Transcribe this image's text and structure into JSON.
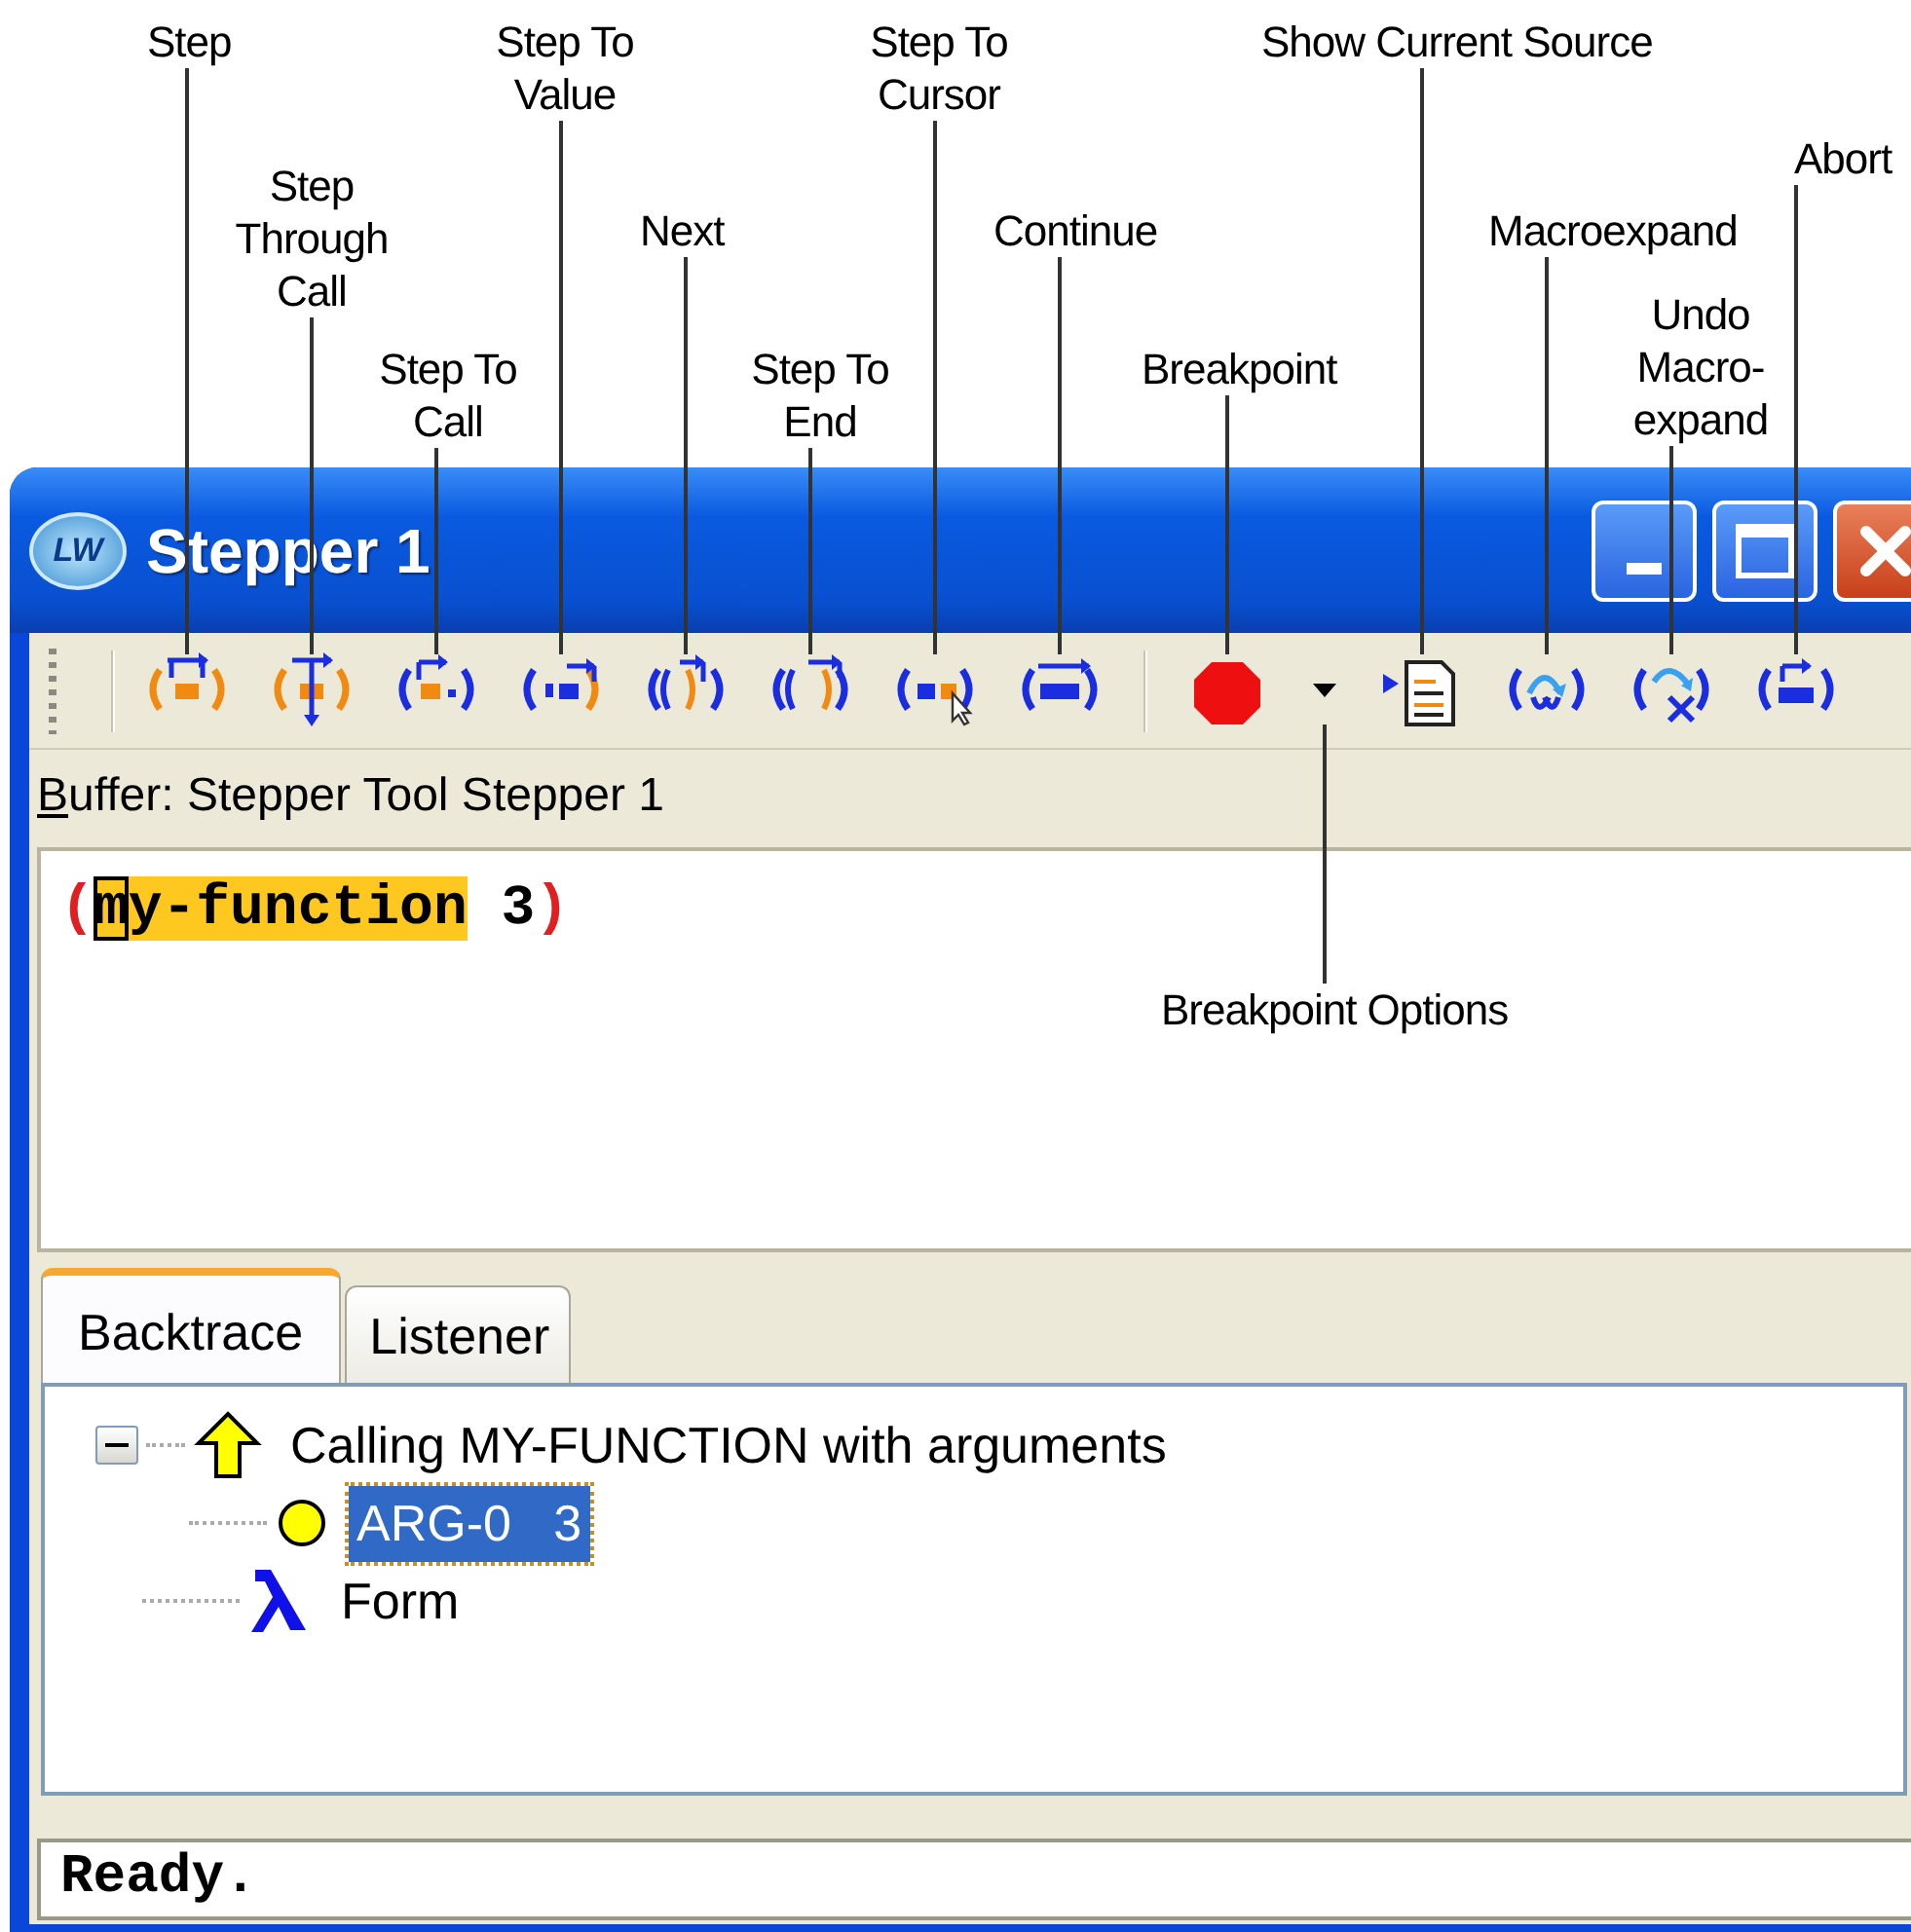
{
  "callouts": [
    {
      "text": "Step"
    },
    {
      "text": "Step Through Call"
    },
    {
      "text": "Step To Call"
    },
    {
      "text": "Step To Value"
    },
    {
      "text": "Next"
    },
    {
      "text": "Step To End"
    },
    {
      "text": "Step To Cursor"
    },
    {
      "text": "Continue"
    },
    {
      "text": "Breakpoint"
    },
    {
      "text": "Show Current Source"
    },
    {
      "text": "Macroexpand"
    },
    {
      "text": "Undo Macro-expand"
    },
    {
      "text": "Abort"
    },
    {
      "text": "Breakpoint Options"
    }
  ],
  "window": {
    "logo": "LW",
    "title": "Stepper 1"
  },
  "buffer": {
    "text": "Buffer: Stepper Tool Stepper 1",
    "accelerator_underlined": true
  },
  "editor": {
    "tokens": [
      {
        "text": "(",
        "kind": "paren",
        "highlighted": false,
        "cursor": false
      },
      {
        "text": "m",
        "kind": "symbol",
        "highlighted": true,
        "cursor": true
      },
      {
        "text": "y-function",
        "kind": "symbol",
        "highlighted": true,
        "cursor": false
      },
      {
        "text": " 3",
        "kind": "number",
        "highlighted": false,
        "cursor": false
      },
      {
        "text": ")",
        "kind": "paren",
        "highlighted": false,
        "cursor": false
      }
    ]
  },
  "tabs": [
    {
      "label": "Backtrace",
      "selected": true
    },
    {
      "label": "Listener",
      "selected": false
    }
  ],
  "tree": [
    {
      "label": "Calling MY-FUNCTION with arguments",
      "kind": "call",
      "selected": false,
      "expanded": true,
      "children": [
        {
          "label": "ARG-0   3",
          "kind": "arg",
          "selected": true
        }
      ]
    },
    {
      "label": "Form",
      "kind": "form",
      "selected": false
    }
  ],
  "status_bar": "Ready."
}
